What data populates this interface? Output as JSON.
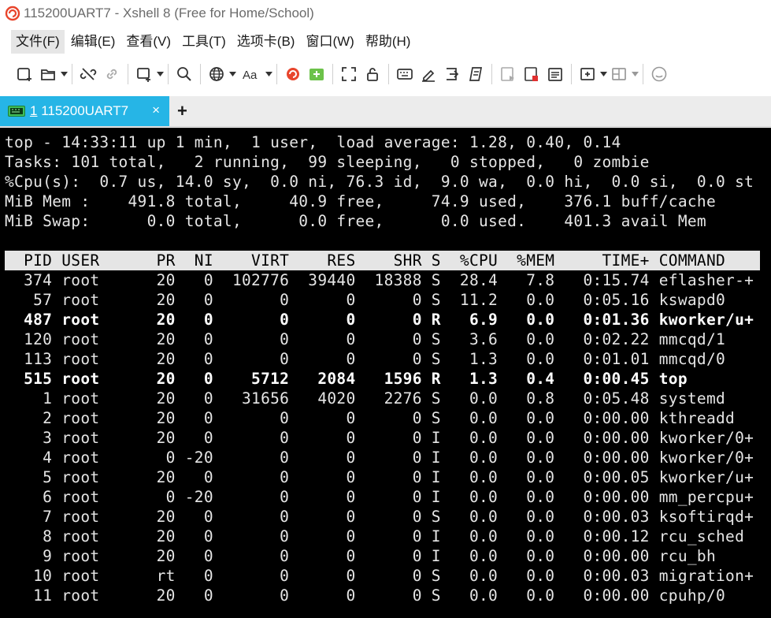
{
  "window": {
    "title": "115200UART7 - Xshell 8 (Free for Home/School)"
  },
  "menu": [
    "文件(F)",
    "编辑(E)",
    "查看(V)",
    "工具(T)",
    "选项卡(B)",
    "窗口(W)",
    "帮助(H)"
  ],
  "toolbar_icons": [
    "new-session-icon",
    "open-folder-icon",
    "disconnect-icon",
    "reconnect-icon",
    "new-window-icon",
    "find-icon",
    "globe-icon",
    "font-icon",
    "xshell-logo-icon",
    "xftp-icon",
    "fullscreen-icon",
    "lock-icon",
    "keyboard-icon",
    "highlight-icon",
    "send-icon",
    "script-icon",
    "record-icon",
    "stop-icon",
    "notes-icon",
    "add-tab-icon",
    "layout-icon",
    "help-icon"
  ],
  "tab": {
    "index": "1",
    "label": "115200UART7",
    "close": "×",
    "add": "+"
  },
  "terminal": {
    "summary": [
      "top - 14:33:11 up 1 min,  1 user,  load average: 1.28, 0.40, 0.14",
      "Tasks: 101 total,   2 running,  99 sleeping,   0 stopped,   0 zombie",
      "%Cpu(s):  0.7 us, 14.0 sy,  0.0 ni, 76.3 id,  9.0 wa,  0.0 hi,  0.0 si,  0.0 st",
      "MiB Mem :    491.8 total,     40.9 free,     74.9 used,    376.1 buff/cache",
      "MiB Swap:      0.0 total,      0.0 free,      0.0 used.    401.3 avail Mem"
    ],
    "header": "  PID USER      PR  NI    VIRT    RES    SHR S  %CPU  %MEM     TIME+ COMMAND",
    "processes": [
      {
        "text": "  374 root      20   0  102776  39440  18388 S  28.4   7.8   0:15.74 eflasher-+",
        "bold": false
      },
      {
        "text": "   57 root      20   0       0      0      0 S  11.2   0.0   0:05.16 kswapd0",
        "bold": false
      },
      {
        "text": "  487 root      20   0       0      0      0 R   6.9   0.0   0:01.36 kworker/u+",
        "bold": true
      },
      {
        "text": "  120 root      20   0       0      0      0 S   3.6   0.0   0:02.22 mmcqd/1",
        "bold": false
      },
      {
        "text": "  113 root      20   0       0      0      0 S   1.3   0.0   0:01.01 mmcqd/0",
        "bold": false
      },
      {
        "text": "  515 root      20   0    5712   2084   1596 R   1.3   0.4   0:00.45 top",
        "bold": true
      },
      {
        "text": "    1 root      20   0   31656   4020   2276 S   0.0   0.8   0:05.48 systemd",
        "bold": false
      },
      {
        "text": "    2 root      20   0       0      0      0 S   0.0   0.0   0:00.00 kthreadd",
        "bold": false
      },
      {
        "text": "    3 root      20   0       0      0      0 I   0.0   0.0   0:00.00 kworker/0+",
        "bold": false
      },
      {
        "text": "    4 root       0 -20       0      0      0 I   0.0   0.0   0:00.00 kworker/0+",
        "bold": false
      },
      {
        "text": "    5 root      20   0       0      0      0 I   0.0   0.0   0:00.05 kworker/u+",
        "bold": false
      },
      {
        "text": "    6 root       0 -20       0      0      0 I   0.0   0.0   0:00.00 mm_percpu+",
        "bold": false
      },
      {
        "text": "    7 root      20   0       0      0      0 S   0.0   0.0   0:00.03 ksoftirqd+",
        "bold": false
      },
      {
        "text": "    8 root      20   0       0      0      0 I   0.0   0.0   0:00.12 rcu_sched",
        "bold": false
      },
      {
        "text": "    9 root      20   0       0      0      0 I   0.0   0.0   0:00.00 rcu_bh",
        "bold": false
      },
      {
        "text": "   10 root      rt   0       0      0      0 S   0.0   0.0   0:00.03 migration+",
        "bold": false
      },
      {
        "text": "   11 root      20   0       0      0      0 S   0.0   0.0   0:00.00 cpuhp/0",
        "bold": false
      }
    ]
  }
}
